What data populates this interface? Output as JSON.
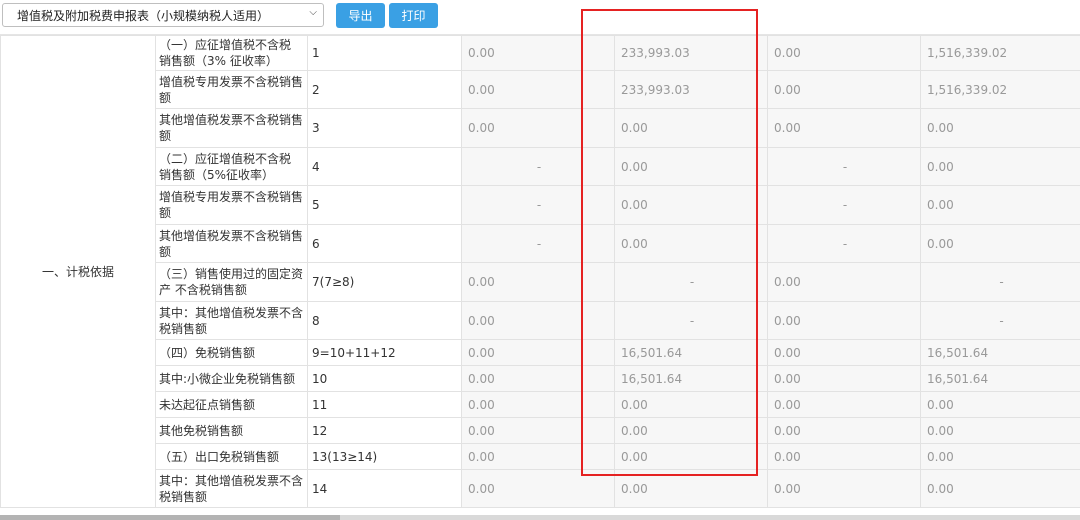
{
  "toolbar": {
    "report_select": "增值税及附加税费申报表（小规模纳税人适用）",
    "export_label": "导出",
    "print_label": "打印"
  },
  "table": {
    "category": "一、计税依据",
    "rows": [
      {
        "name": "（一）应征增值税不含税 销售额（3% 征收率）",
        "num": "1",
        "c1": "0.00",
        "c2": "233,993.03",
        "c3": "0.00",
        "c4": "1,516,339.02"
      },
      {
        "name": "增值税专用发票不含税销售额",
        "num": "2",
        "c1": "0.00",
        "c2": "233,993.03",
        "c3": "0.00",
        "c4": "1,516,339.02"
      },
      {
        "name": "其他增值税发票不含税销售额",
        "num": "3",
        "c1": "0.00",
        "c2": "0.00",
        "c3": "0.00",
        "c4": "0.00"
      },
      {
        "name": "（二）应征增值税不含税 销售额（5%征收率）",
        "num": "4",
        "c1": "-",
        "c2": "0.00",
        "c3": "-",
        "c4": "0.00"
      },
      {
        "name": "增值税专用发票不含税销售额",
        "num": "5",
        "c1": "-",
        "c2": "0.00",
        "c3": "-",
        "c4": "0.00"
      },
      {
        "name": "其他增值税发票不含税销售额",
        "num": "6",
        "c1": "-",
        "c2": "0.00",
        "c3": "-",
        "c4": "0.00"
      },
      {
        "name": "（三）销售使用过的固定资产 不含税销售额",
        "num": "7(7≥8)",
        "c1": "0.00",
        "c2": "-",
        "c3": "0.00",
        "c4": "-"
      },
      {
        "name": "其中：其他增值税发票不含税销售额",
        "num": "8",
        "c1": "0.00",
        "c2": "-",
        "c3": "0.00",
        "c4": "-"
      },
      {
        "name": "（四）免税销售额",
        "num": "9=10+11+12",
        "c1": "0.00",
        "c2": "16,501.64",
        "c3": "0.00",
        "c4": "16,501.64"
      },
      {
        "name": "其中:小微企业免税销售额",
        "num": "10",
        "c1": "0.00",
        "c2": "16,501.64",
        "c3": "0.00",
        "c4": "16,501.64"
      },
      {
        "name": "未达起征点销售额",
        "num": "11",
        "c1": "0.00",
        "c2": "0.00",
        "c3": "0.00",
        "c4": "0.00"
      },
      {
        "name": "其他免税销售额",
        "num": "12",
        "c1": "0.00",
        "c2": "0.00",
        "c3": "0.00",
        "c4": "0.00"
      },
      {
        "name": "（五）出口免税销售额",
        "num": "13(13≥14)",
        "c1": "0.00",
        "c2": "0.00",
        "c3": "0.00",
        "c4": "0.00"
      },
      {
        "name": "其中：其他增值税发票不含税销售额",
        "num": "14",
        "c1": "0.00",
        "c2": "0.00",
        "c3": "0.00",
        "c4": "0.00"
      }
    ]
  },
  "colors": {
    "accent": "#3aa0e4",
    "highlight": "#e52222"
  },
  "icons": {
    "select_arrow": "chevron-down-icon"
  }
}
